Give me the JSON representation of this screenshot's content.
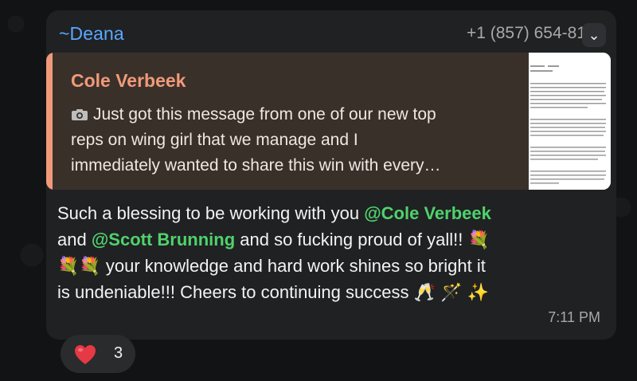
{
  "message": {
    "sender_prefix": "~",
    "sender_name": "Deana",
    "phone": "+1 (857) 654-81",
    "reply": {
      "author": "Cole Verbeek",
      "text_parts": [
        "Just got this message from one of our new top",
        "reps on wing girl that we manage and I",
        "immediately wanted to share this win with every…"
      ]
    },
    "body": {
      "line1_prefix": "Such a blessing to be working with you ",
      "mention1": "@Cole Verbeek",
      "line2_prefix": "and ",
      "mention2": "@Scott Brunning",
      "line2_suffix": " and so fucking proud of yall!! 💐",
      "line3": "💐💐 your knowledge and hard work shines so bright it",
      "line4": "is undeniable!!! Cheers to continuing success 🥂 🪄 ✨"
    },
    "time": "7:11 PM"
  },
  "reaction": {
    "emoji_name": "heart-icon",
    "count": "3",
    "color": "#e53945"
  },
  "colors": {
    "sender": "#5aa7ff",
    "reply_accent": "#f09a7a",
    "mention": "#4fd26c",
    "bubble": "#202123"
  }
}
